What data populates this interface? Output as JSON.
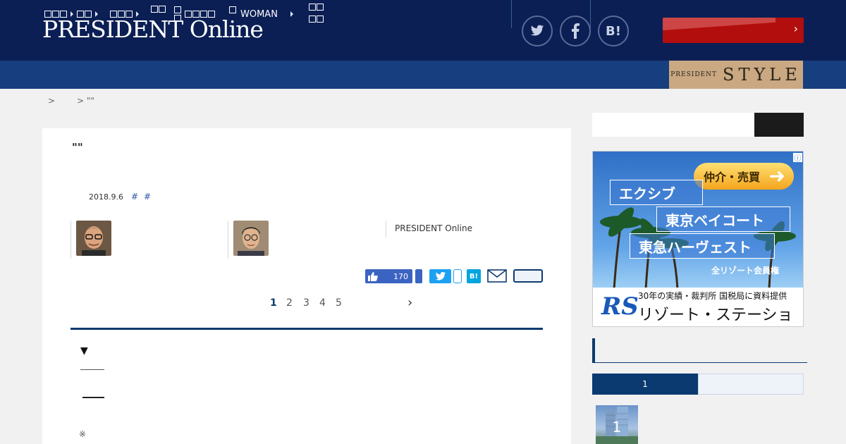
{
  "header": {
    "logo": "PRESIDENT Online",
    "social": [
      {
        "name": "twitter-icon"
      },
      {
        "name": "facebook-icon"
      },
      {
        "name": "hatena-icon",
        "label": "B!"
      }
    ],
    "cta": {
      "label": "",
      "arrow": "›"
    }
  },
  "nav": {
    "items": [
      {
        "label": "",
        "has_arrow": true
      },
      {
        "label": "",
        "has_arrow": true
      },
      {
        "label": "",
        "has_arrow": true
      },
      {
        "label": ""
      },
      {
        "label": ""
      },
      {
        "label": "WOMAN",
        "has_arrow": true
      },
      {
        "label": ""
      }
    ],
    "style_banner": {
      "small": "PRESIDENT",
      "big": "STYLE"
    }
  },
  "breadcrumb": [
    ">",
    "> \"\""
  ],
  "article": {
    "title": "\"\"",
    "date": "2018.9.6",
    "tags": [
      "#",
      "#"
    ],
    "source": "PRESIDENT Online",
    "like_count": "170",
    "hatena_label": "B!",
    "pages": [
      "1",
      "2",
      "3",
      "4",
      "5"
    ],
    "current_page": "1",
    "next_arrow": "›",
    "bullet": "▼",
    "note": "※"
  },
  "sidebar": {
    "search": {
      "placeholder": ""
    },
    "ad": {
      "pill": "仲介・売買",
      "boxes": [
        "エクシブ",
        "東京ベイコート",
        "東急ハーヴェスト"
      ],
      "member": "全リゾート会員権",
      "info": "ⓘ",
      "logo": "RS",
      "sub": "30年の実績・裁判所 国税局に資料提供",
      "name": "リゾート・ステーション"
    },
    "ranking": {
      "tabs": [
        "1",
        ""
      ],
      "first_rank": "1"
    }
  },
  "colors": {
    "header_bg": "#0b1f55",
    "nav_bg": "#173e7e",
    "accent": "#0b3a70",
    "cta": "#b30e0e"
  }
}
